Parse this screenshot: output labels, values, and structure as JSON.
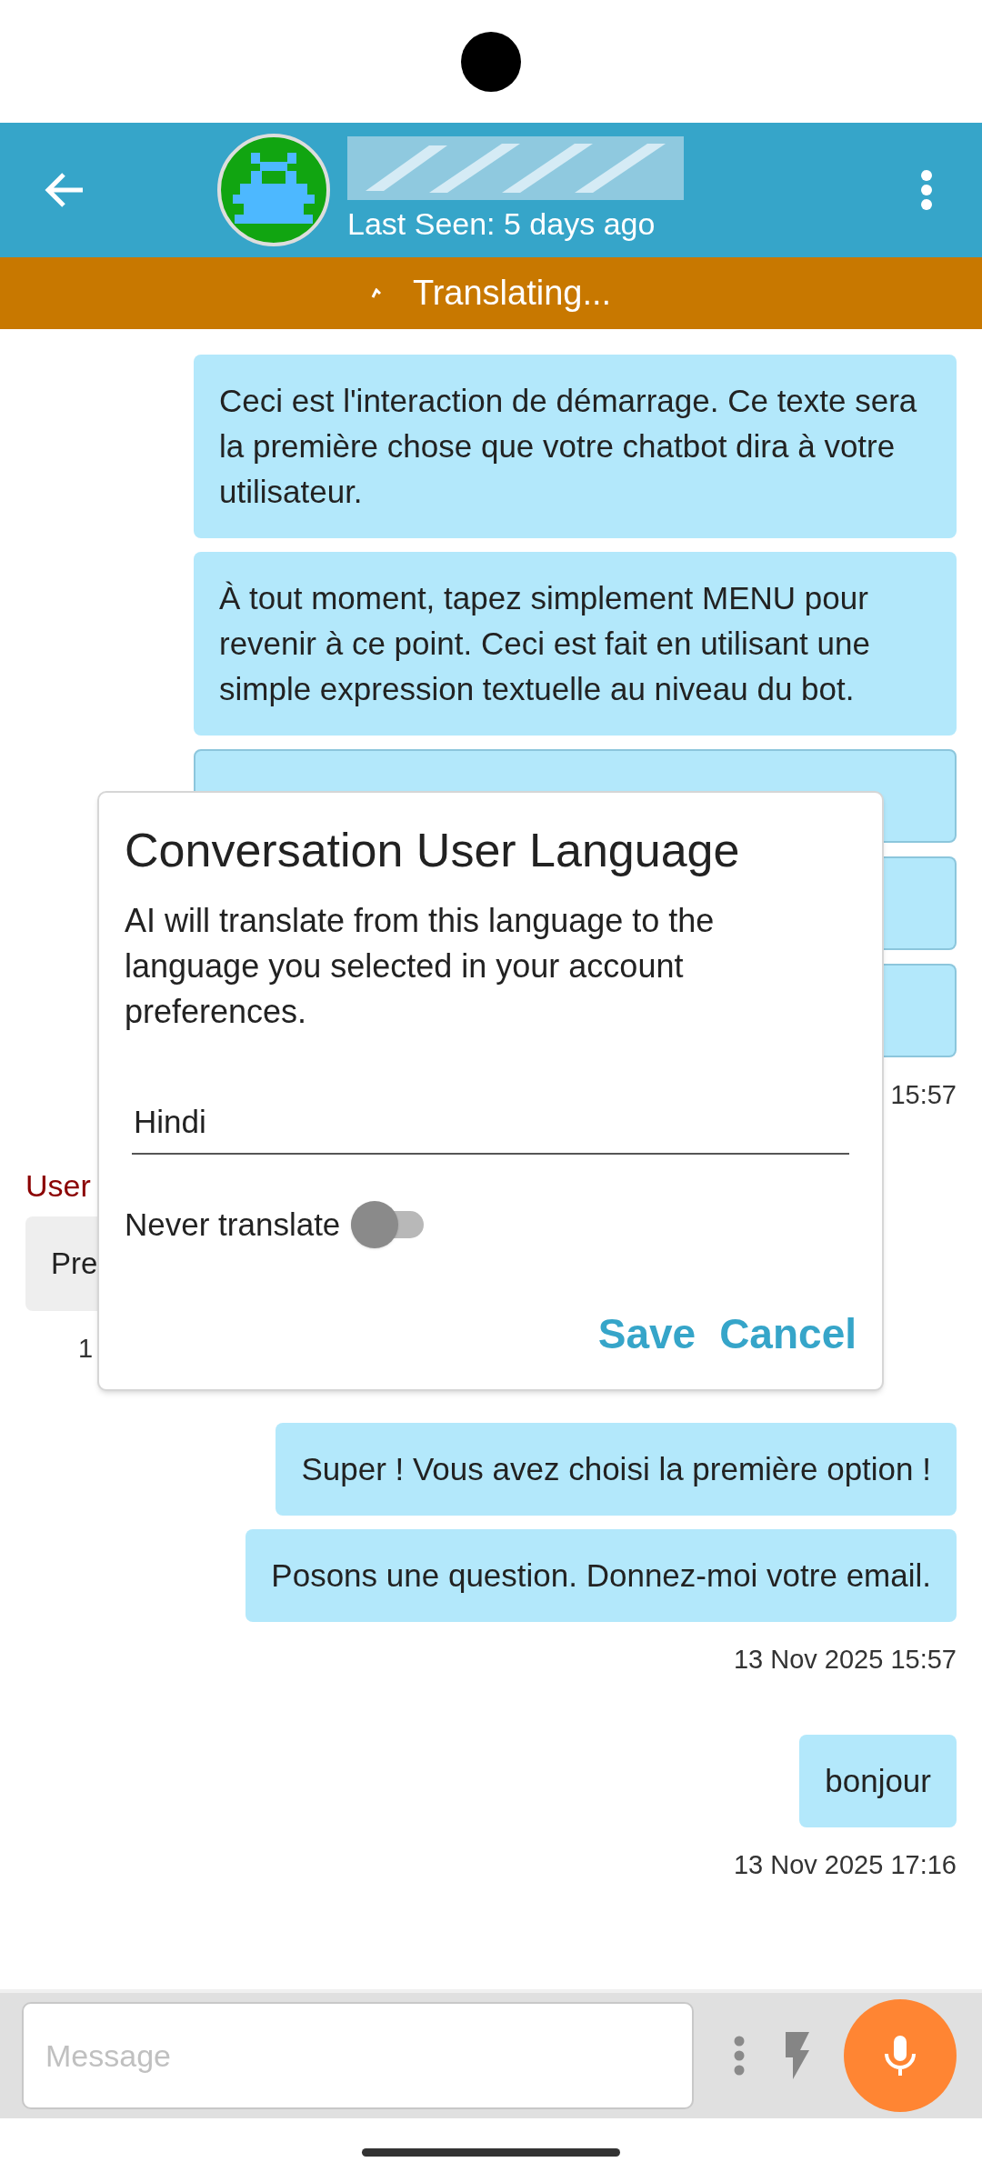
{
  "header": {
    "last_seen": "Last Seen: 5 days ago"
  },
  "banner": {
    "text": "Translating..."
  },
  "messages": [
    {
      "kind": "bubble",
      "text": "Ceci est l'interaction de démarrage. Ce texte sera la première chose que votre chatbot dira à votre utilisateur."
    },
    {
      "kind": "bubble",
      "text": "À tout moment, tapez simplement MENU pour revenir à ce point. Ceci est fait en utilisant une simple expression textuelle au niveau du bot."
    },
    {
      "kind": "option"
    },
    {
      "kind": "option"
    },
    {
      "kind": "option"
    },
    {
      "kind": "time_right",
      "text": "15:57"
    },
    {
      "kind": "sender",
      "text": "User"
    },
    {
      "kind": "user_bubble",
      "text": "Pre"
    },
    {
      "kind": "time_left",
      "text": "1"
    },
    {
      "kind": "bubble",
      "text": "Super ! Vous avez choisi la première option !"
    },
    {
      "kind": "bubble",
      "text": "Posons une question. Donnez-moi votre email."
    },
    {
      "kind": "time_right",
      "text": "13 Nov 2025 15:57"
    },
    {
      "kind": "bubble",
      "text": "bonjour"
    },
    {
      "kind": "time_right",
      "text": "13 Nov 2025 17:16"
    }
  ],
  "dialog": {
    "title": "Conversation User Language",
    "body": "AI will translate from this language to the language you selected in your account preferences.",
    "language_value": "Hindi",
    "never_translate": {
      "label": "Never translate",
      "on": false
    },
    "buttons": [
      "Save",
      "Cancel"
    ]
  },
  "composer": {
    "placeholder": "Message"
  }
}
